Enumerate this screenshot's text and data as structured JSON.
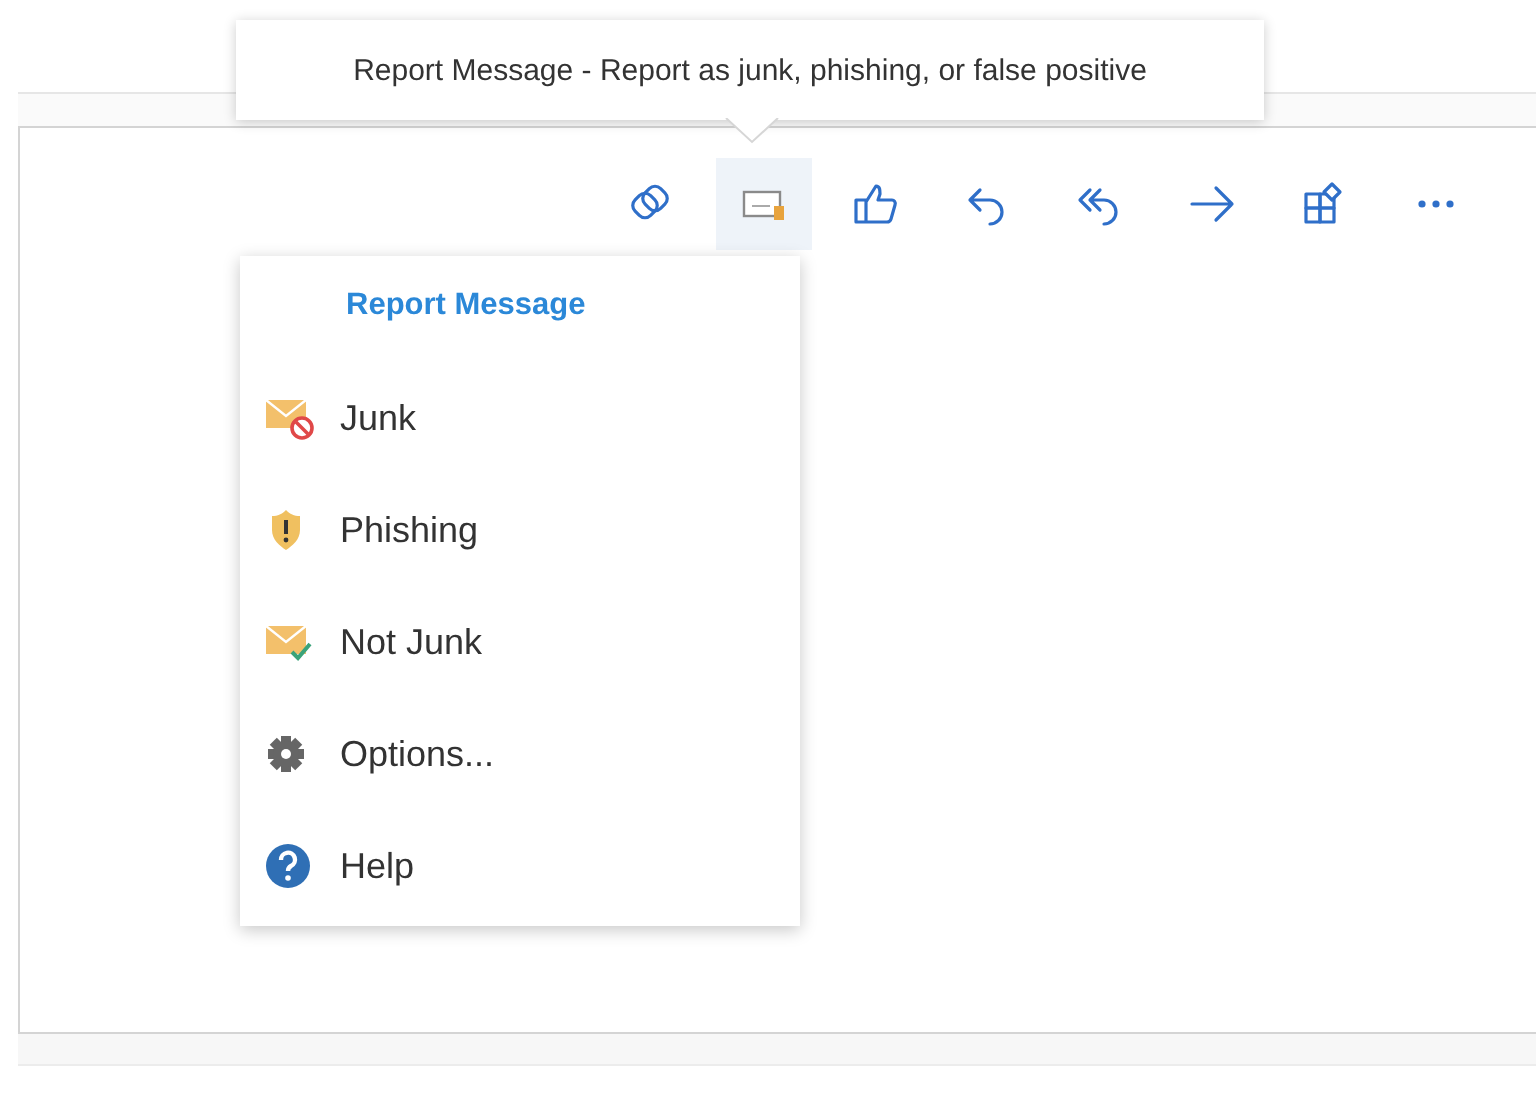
{
  "tooltip": {
    "text": "Report Message - Report as junk, phishing, or false positive"
  },
  "toolbar": [
    {
      "kind": "loop",
      "selected": false
    },
    {
      "kind": "report",
      "selected": true
    },
    {
      "kind": "like",
      "selected": false
    },
    {
      "kind": "reply",
      "selected": false
    },
    {
      "kind": "reply_all",
      "selected": false
    },
    {
      "kind": "forward",
      "selected": false
    },
    {
      "kind": "apps",
      "selected": false
    },
    {
      "kind": "more",
      "selected": false
    }
  ],
  "menu": {
    "title": "Report Message",
    "items": [
      {
        "kind": "junk",
        "label": "Junk"
      },
      {
        "kind": "phishing",
        "label": "Phishing"
      },
      {
        "kind": "not_junk",
        "label": "Not Junk"
      },
      {
        "kind": "options",
        "label": "Options..."
      },
      {
        "kind": "help",
        "label": "Help"
      }
    ]
  }
}
